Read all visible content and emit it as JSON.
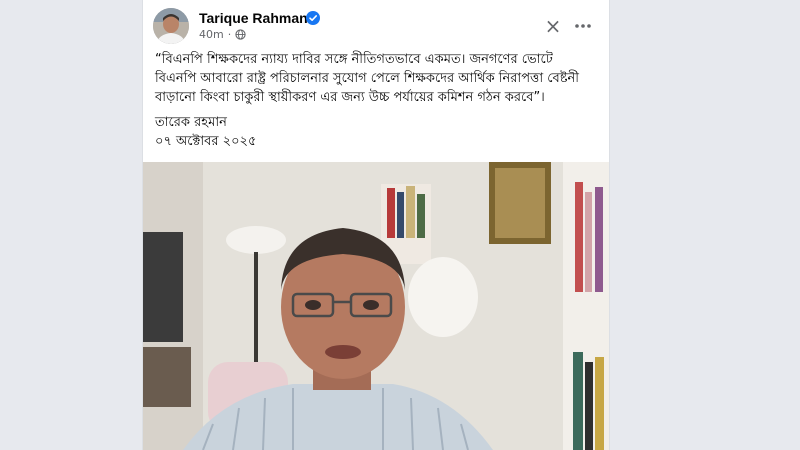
{
  "post": {
    "author": "Tarique Rahman",
    "time": "40m",
    "separator": "·",
    "body": "“বিএনপি শিক্ষকদের ন্যায্য দাবির সঙ্গে নীতিগতভাবে একমত। জনগণের ভোটে বিএনপি আবারো রাষ্ট্র পরিচালনার সুযোগ পেলে শিক্ষকদের আর্থিক নিরাপত্তা বেষ্টনী বাড়ানো কিংবা চাকুরী স্থায়ীকরণ এর জন্য উচ্চ পর্যায়ের কমিশন গঠন করবে”।",
    "signature_name": "তারেক রহমান",
    "signature_date": "০৭ অক্টোবর ২০২৫",
    "close_glyph": "×"
  },
  "icons": {
    "verified": "verified-badge-icon",
    "audience": "globe-icon",
    "more": "more-options-icon",
    "close": "close-icon"
  },
  "colors": {
    "verified": "#1877f2",
    "text_primary": "#050505",
    "text_secondary": "#65676b"
  }
}
